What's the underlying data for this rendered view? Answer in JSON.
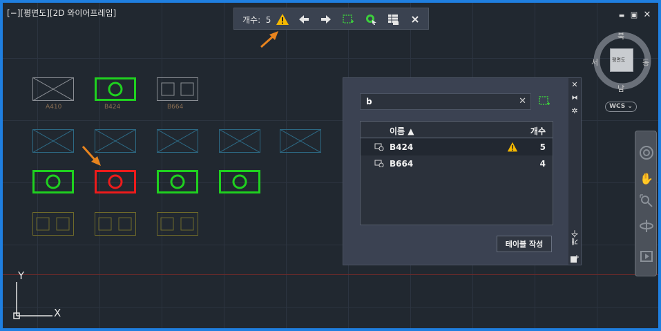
{
  "viewport": {
    "label": "[−][평면도][2D 와이어프레임]"
  },
  "window_controls": {
    "minimize": "▬",
    "restore": "▣",
    "close": "✕"
  },
  "count_toolbar": {
    "label": "개수:",
    "count": "5"
  },
  "blocks": {
    "labels": [
      "A410",
      "B424",
      "B664"
    ]
  },
  "panel": {
    "search_value": "b",
    "columns": {
      "name": "이름",
      "count": "개수"
    },
    "rows": [
      {
        "name": "B424",
        "count": "5",
        "warning": true
      },
      {
        "name": "B664",
        "count": "4",
        "warning": false
      }
    ],
    "make_table_button": "테이블 작성",
    "side_title": "개수"
  },
  "viewcube": {
    "north": "북",
    "south": "남",
    "east": "동",
    "west": "서",
    "face": "평면도",
    "wcs": "WCS"
  },
  "ucs": {
    "x": "X",
    "y": "Y"
  },
  "colors": {
    "accent_border": "#1f7fe0",
    "warning": "#f5b800",
    "annotation_arrow": "#e8841e",
    "green_block": "#1fd11f",
    "red_block": "#ee1b1b"
  }
}
